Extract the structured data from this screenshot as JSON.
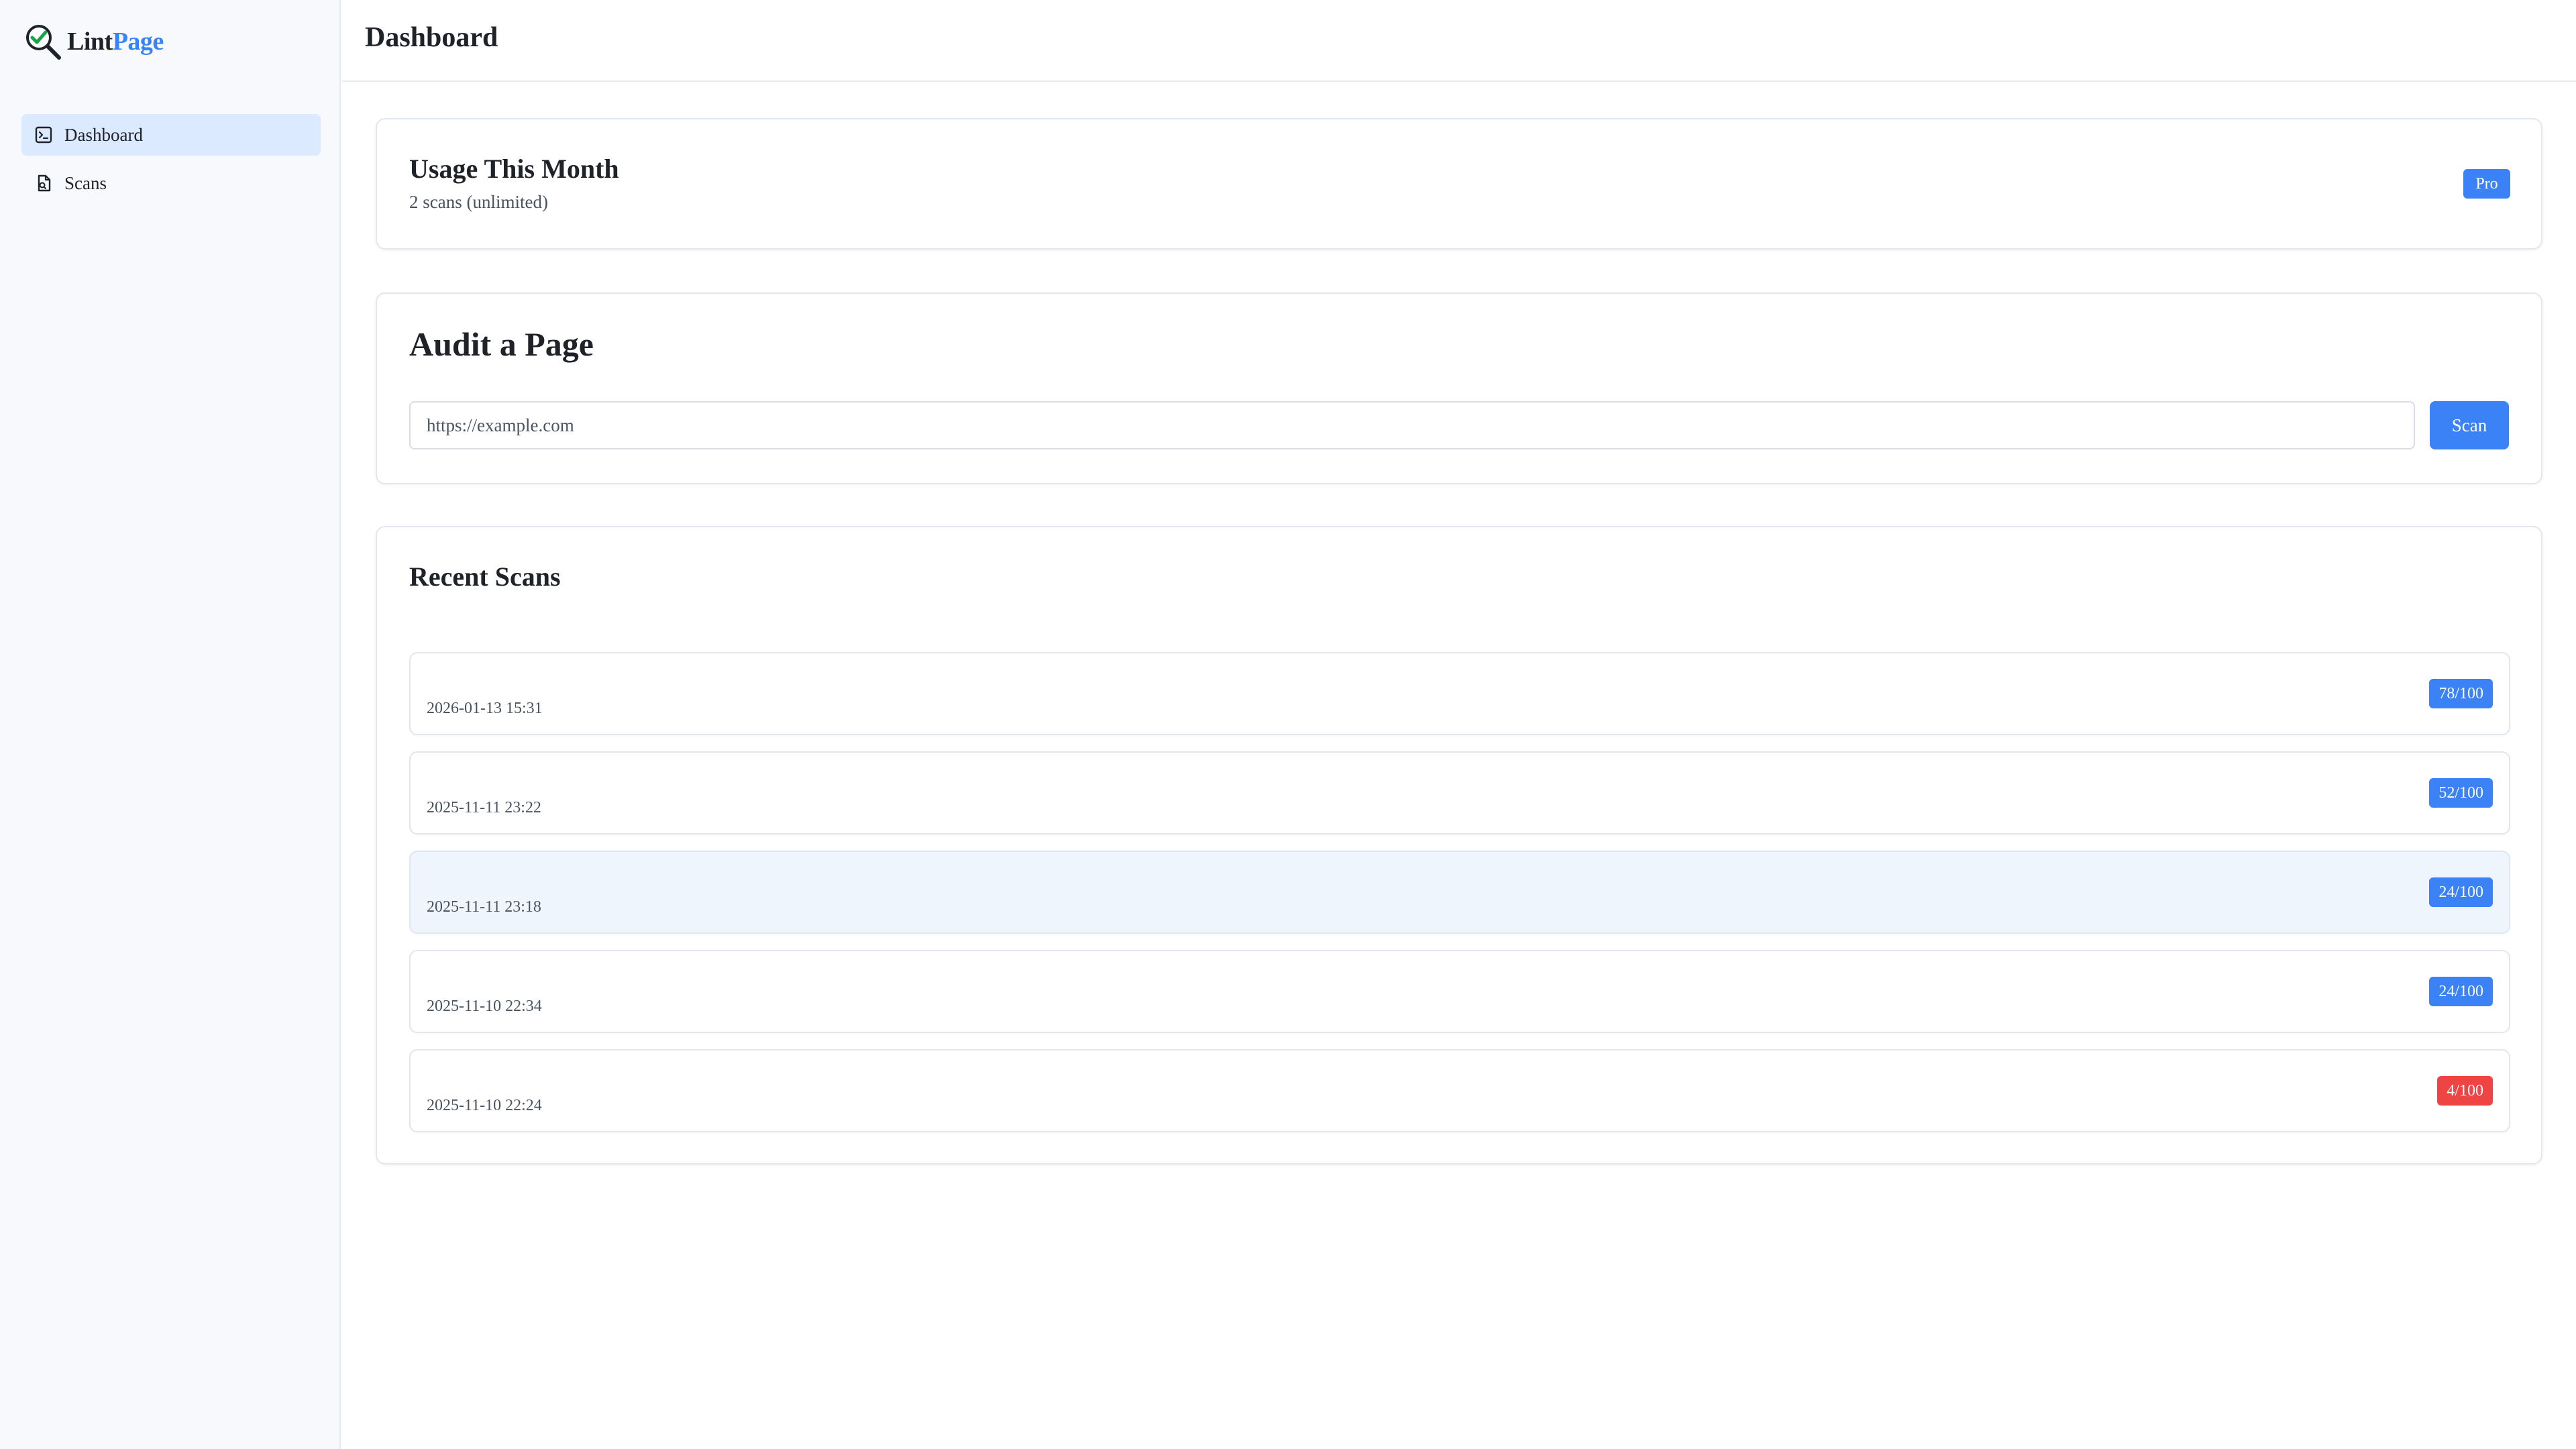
{
  "brand": {
    "name_part1": "Lint",
    "name_part2": "Page",
    "logo_icon": "magnifier-check-icon"
  },
  "sidebar": {
    "items": [
      {
        "label": "Dashboard",
        "icon": "chart-square-icon",
        "active": true
      },
      {
        "label": "Scans",
        "icon": "document-icon",
        "active": false
      }
    ]
  },
  "header": {
    "title": "Dashboard"
  },
  "usage": {
    "title": "Usage This Month",
    "subtitle": "2 scans (unlimited)",
    "plan_badge": "Pro"
  },
  "audit": {
    "title": "Audit a Page",
    "placeholder": "https://example.com",
    "button_label": "Scan"
  },
  "recent": {
    "title": "Recent Scans",
    "scans": [
      {
        "date": "2026-01-13 15:31",
        "score": "78/100",
        "level": "ok"
      },
      {
        "date": "2025-11-11 23:22",
        "score": "52/100",
        "level": "ok"
      },
      {
        "date": "2025-11-11 23:18",
        "score": "24/100",
        "level": "ok"
      },
      {
        "date": "2025-11-10 22:34",
        "score": "24/100",
        "level": "ok"
      },
      {
        "date": "2025-11-10 22:24",
        "score": "4/100",
        "level": "low"
      }
    ]
  },
  "colors": {
    "accent": "#3b82f6",
    "danger": "#ef4444",
    "active_nav": "#dbeafe",
    "sidebar_bg": "#f7f9fc"
  }
}
